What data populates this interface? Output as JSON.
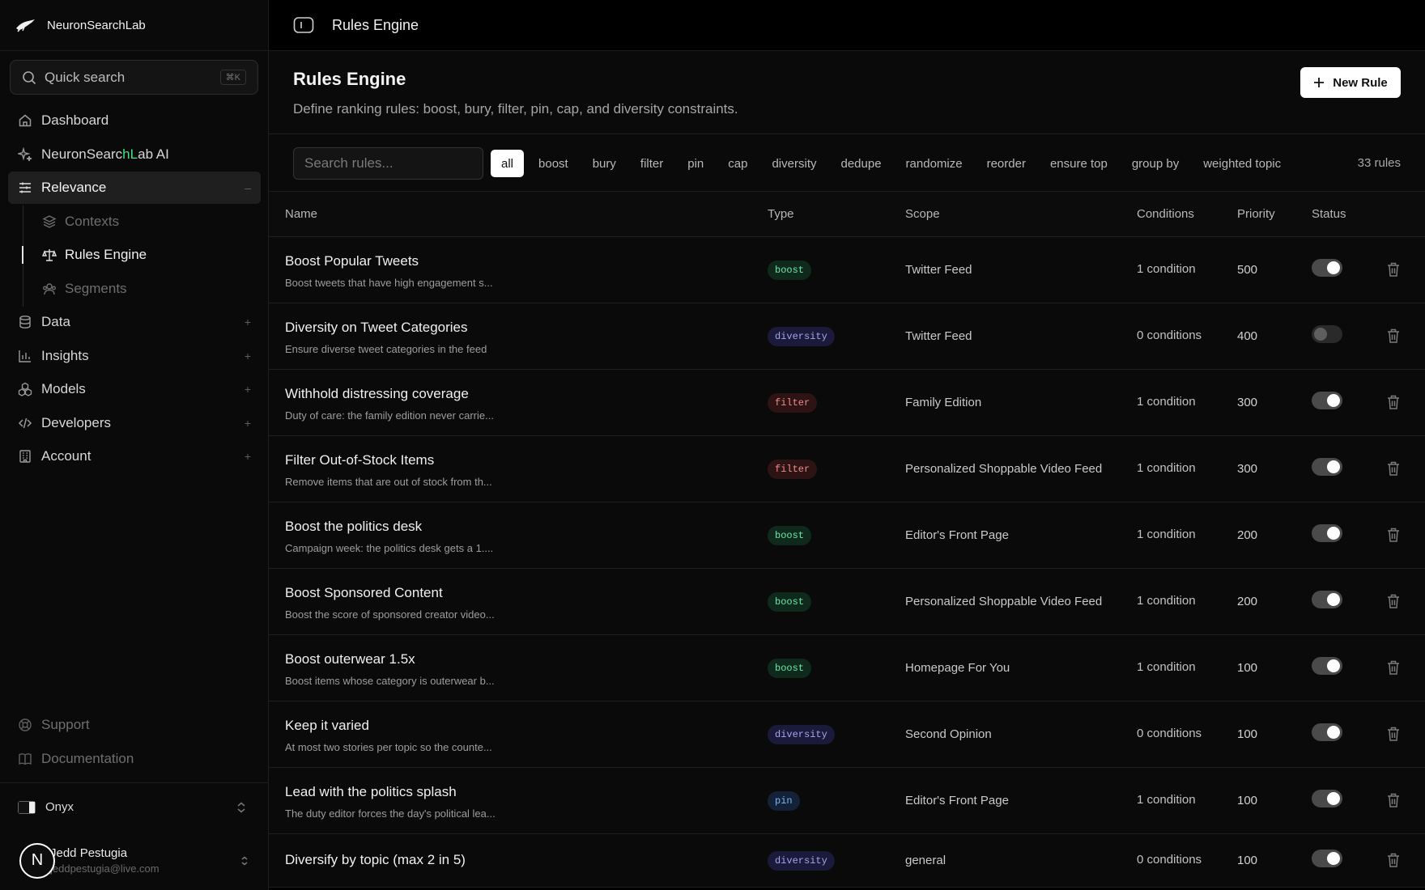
{
  "brand": {
    "name": "NeuronSearchLab"
  },
  "sidebar": {
    "quick_search": {
      "label": "Quick search",
      "shortcut": "⌘K"
    },
    "dashboard": "Dashboard",
    "ai": {
      "prefix": "NeuronSearc",
      "h": "h",
      "l": "L",
      "suffix": "ab AI"
    },
    "relevance": {
      "label": "Relevance",
      "indicator": "–"
    },
    "sub": {
      "contexts": "Contexts",
      "rules": "Rules Engine",
      "segments": "Segments"
    },
    "data": {
      "label": "Data",
      "indicator": "+"
    },
    "insights": {
      "label": "Insights",
      "indicator": "+"
    },
    "models": {
      "label": "Models",
      "indicator": "+"
    },
    "developers": {
      "label": "Developers",
      "indicator": "+"
    },
    "account": {
      "label": "Account",
      "indicator": "+"
    },
    "support": "Support",
    "documentation": "Documentation",
    "theme": "Onyx",
    "user": {
      "initial": "N",
      "name": "Jedd Pestugia",
      "email": "jeddpestugia@live.com"
    }
  },
  "topbar": {
    "title": "Rules Engine"
  },
  "header": {
    "title": "Rules Engine",
    "subtitle": "Define ranking rules: boost, bury, filter, pin, cap, and diversity constraints.",
    "new_rule": "New Rule"
  },
  "filters": {
    "search_placeholder": "Search rules...",
    "chips": [
      "all",
      "boost",
      "bury",
      "filter",
      "pin",
      "cap",
      "diversity",
      "dedupe",
      "randomize",
      "reorder",
      "ensure top",
      "group by",
      "weighted topic"
    ],
    "count": "33 rules"
  },
  "table": {
    "headers": {
      "name": "Name",
      "type": "Type",
      "scope": "Scope",
      "conditions": "Conditions",
      "priority": "Priority",
      "status": "Status"
    },
    "rows": [
      {
        "name": "Boost Popular Tweets",
        "desc": "Boost tweets that have high engagement s...",
        "type": "boost",
        "scope": "Twitter Feed",
        "conditions": "1 condition",
        "priority": "500",
        "enabled": true
      },
      {
        "name": "Diversity on Tweet Categories",
        "desc": "Ensure diverse tweet categories in the feed",
        "type": "diversity",
        "scope": "Twitter Feed",
        "conditions": "0 conditions",
        "priority": "400",
        "enabled": false
      },
      {
        "name": "Withhold distressing coverage",
        "desc": "Duty of care: the family edition never carrie...",
        "type": "filter",
        "scope": "Family Edition",
        "conditions": "1 condition",
        "priority": "300",
        "enabled": true
      },
      {
        "name": "Filter Out-of-Stock Items",
        "desc": "Remove items that are out of stock from th...",
        "type": "filter",
        "scope": "Personalized Shoppable Video Feed",
        "conditions": "1 condition",
        "priority": "300",
        "enabled": true
      },
      {
        "name": "Boost the politics desk",
        "desc": "Campaign week: the politics desk gets a 1....",
        "type": "boost",
        "scope": "Editor's Front Page",
        "conditions": "1 condition",
        "priority": "200",
        "enabled": true
      },
      {
        "name": "Boost Sponsored Content",
        "desc": "Boost the score of sponsored creator video...",
        "type": "boost",
        "scope": "Personalized Shoppable Video Feed",
        "conditions": "1 condition",
        "priority": "200",
        "enabled": true
      },
      {
        "name": "Boost outerwear 1.5x",
        "desc": "Boost items whose category is outerwear b...",
        "type": "boost",
        "scope": "Homepage For You",
        "conditions": "1 condition",
        "priority": "100",
        "enabled": true
      },
      {
        "name": "Keep it varied",
        "desc": "At most two stories per topic so the counte...",
        "type": "diversity",
        "scope": "Second Opinion",
        "conditions": "0 conditions",
        "priority": "100",
        "enabled": true
      },
      {
        "name": "Lead with the politics splash",
        "desc": "The duty editor forces the day's political lea...",
        "type": "pin",
        "scope": "Editor's Front Page",
        "conditions": "1 condition",
        "priority": "100",
        "enabled": true
      },
      {
        "name": "Diversify by topic (max 2 in 5)",
        "desc": "",
        "type": "diversity",
        "scope": "general",
        "conditions": "0 conditions",
        "priority": "100",
        "enabled": true
      }
    ]
  }
}
